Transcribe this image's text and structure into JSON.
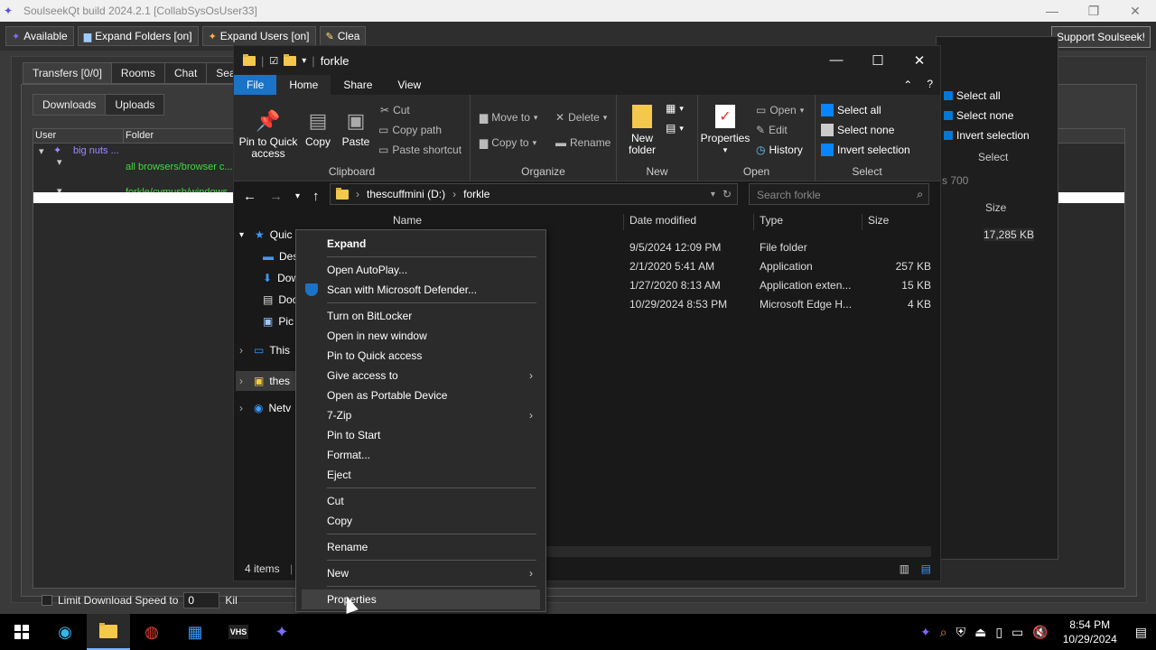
{
  "soulseek": {
    "title": "SoulseekQt build 2024.2.1 [CollabSysOsUser33]",
    "toolbar": {
      "status": "Available",
      "expand_folders": "Expand Folders [on]",
      "expand_users": "Expand Users [on]",
      "clear": "Clea"
    },
    "support": "Support Soulseek!",
    "tabs": [
      "Transfers [0/0]",
      "Rooms",
      "Chat",
      "Search"
    ],
    "subtabs": [
      "Downloads",
      "Uploads"
    ],
    "columns": {
      "user": "User",
      "folder": "Folder"
    },
    "rows": {
      "user": "big nuts ...",
      "folder1": "all browsers/browser c...",
      "folder2": "forkle/cvmusb/windows"
    },
    "limit_label": "Limit Download Speed to",
    "limit_value": "0",
    "limit_unit": "Kil"
  },
  "explorer2": {
    "select_all": "Select all",
    "select_none": "Select none",
    "invert": "Invert selection",
    "group": "Select",
    "search": "s 700",
    "size_col": "Size",
    "size_val": "17,285 KB"
  },
  "explorer": {
    "title": "forkle",
    "ribbon_tabs": [
      "File",
      "Home",
      "Share",
      "View"
    ],
    "clipboard": {
      "pin": "Pin to Quick access",
      "copy": "Copy",
      "paste": "Paste",
      "cut": "Cut",
      "copy_path": "Copy path",
      "paste_shortcut": "Paste shortcut",
      "label": "Clipboard"
    },
    "organize": {
      "move_to": "Move to",
      "copy_to": "Copy to",
      "delete": "Delete",
      "rename": "Rename",
      "label": "Organize"
    },
    "new": {
      "new_folder": "New folder",
      "label": "New"
    },
    "open": {
      "properties": "Properties",
      "open": "Open",
      "edit": "Edit",
      "history": "History",
      "label": "Open"
    },
    "select": {
      "select_all": "Select all",
      "select_none": "Select none",
      "invert": "Invert selection",
      "label": "Select"
    },
    "address": {
      "drive": "thescuffmini (D:)",
      "folder": "forkle"
    },
    "search_placeholder": "Search forkle",
    "columns": {
      "name": "Name",
      "date": "Date modified",
      "type": "Type",
      "size": "Size"
    },
    "files": [
      {
        "date": "9/5/2024 12:09 PM",
        "type": "File folder",
        "size": ""
      },
      {
        "date": "2/1/2020 5:41 AM",
        "type": "Application",
        "size": "257 KB"
      },
      {
        "date": "1/27/2020 8:13 AM",
        "type": "Application exten...",
        "size": "15 KB"
      },
      {
        "date": "10/29/2024 8:53 PM",
        "type": "Microsoft Edge H...",
        "size": "4 KB"
      }
    ],
    "nav": {
      "quick": "Quic",
      "desktop": "Des",
      "downloads": "Dow",
      "documents": "Doc",
      "pictures": "Pic",
      "this_pc": "This",
      "drive": "thes",
      "network": "Netv"
    },
    "status": "4 items"
  },
  "context_menu": {
    "expand": "Expand",
    "autoplay": "Open AutoPlay...",
    "defender": "Scan with Microsoft Defender...",
    "bitlocker": "Turn on BitLocker",
    "new_window": "Open in new window",
    "pin_quick": "Pin to Quick access",
    "give_access": "Give access to",
    "portable": "Open as Portable Device",
    "zip": "7-Zip",
    "pin_start": "Pin to Start",
    "format": "Format...",
    "eject": "Eject",
    "cut": "Cut",
    "copy": "Copy",
    "rename": "Rename",
    "new": "New",
    "properties": "Properties"
  },
  "taskbar": {
    "time": "8:54 PM",
    "date": "10/29/2024",
    "vhs_label": "VHS"
  }
}
